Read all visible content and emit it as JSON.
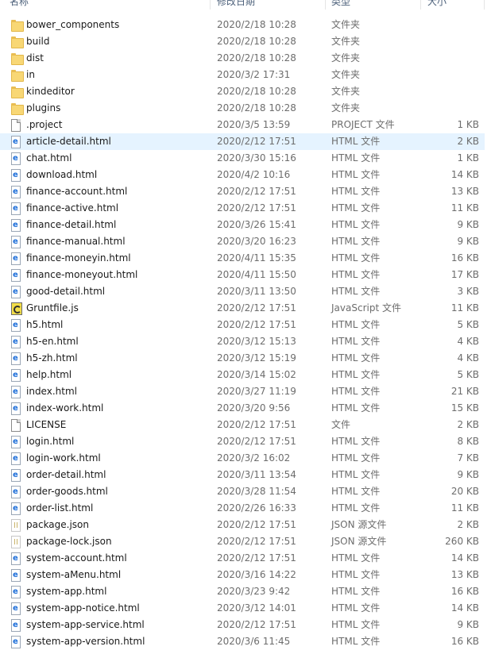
{
  "header": {
    "name": "名称",
    "date": "修改日期",
    "type": "类型",
    "size": "大小"
  },
  "files": [
    {
      "icon": "folder",
      "name": "bower_components",
      "date": "2020/2/18 10:28",
      "type": "文件夹",
      "size": ""
    },
    {
      "icon": "folder",
      "name": "build",
      "date": "2020/2/18 10:28",
      "type": "文件夹",
      "size": ""
    },
    {
      "icon": "folder",
      "name": "dist",
      "date": "2020/2/18 10:28",
      "type": "文件夹",
      "size": ""
    },
    {
      "icon": "folder",
      "name": "in",
      "date": "2020/3/2 17:31",
      "type": "文件夹",
      "size": ""
    },
    {
      "icon": "folder",
      "name": "kindeditor",
      "date": "2020/2/18 10:28",
      "type": "文件夹",
      "size": ""
    },
    {
      "icon": "folder",
      "name": "plugins",
      "date": "2020/2/18 10:28",
      "type": "文件夹",
      "size": ""
    },
    {
      "icon": "file",
      "name": ".project",
      "date": "2020/3/5 13:59",
      "type": "PROJECT 文件",
      "size": "1 KB"
    },
    {
      "icon": "html",
      "name": "article-detail.html",
      "date": "2020/2/12 17:51",
      "type": "HTML 文件",
      "size": "2 KB",
      "selected": true
    },
    {
      "icon": "html",
      "name": "chat.html",
      "date": "2020/3/30 15:16",
      "type": "HTML 文件",
      "size": "1 KB"
    },
    {
      "icon": "html",
      "name": "download.html",
      "date": "2020/4/2 10:16",
      "type": "HTML 文件",
      "size": "14 KB"
    },
    {
      "icon": "html",
      "name": "finance-account.html",
      "date": "2020/2/12 17:51",
      "type": "HTML 文件",
      "size": "13 KB"
    },
    {
      "icon": "html",
      "name": "finance-active.html",
      "date": "2020/2/12 17:51",
      "type": "HTML 文件",
      "size": "11 KB"
    },
    {
      "icon": "html",
      "name": "finance-detail.html",
      "date": "2020/3/26 15:41",
      "type": "HTML 文件",
      "size": "9 KB"
    },
    {
      "icon": "html",
      "name": "finance-manual.html",
      "date": "2020/3/20 16:23",
      "type": "HTML 文件",
      "size": "9 KB"
    },
    {
      "icon": "html",
      "name": "finance-moneyin.html",
      "date": "2020/4/11 15:35",
      "type": "HTML 文件",
      "size": "16 KB"
    },
    {
      "icon": "html",
      "name": "finance-moneyout.html",
      "date": "2020/4/11 15:50",
      "type": "HTML 文件",
      "size": "17 KB"
    },
    {
      "icon": "html",
      "name": "good-detail.html",
      "date": "2020/3/11 13:50",
      "type": "HTML 文件",
      "size": "3 KB"
    },
    {
      "icon": "js",
      "name": "Gruntfile.js",
      "date": "2020/2/12 17:51",
      "type": "JavaScript 文件",
      "size": "11 KB"
    },
    {
      "icon": "html",
      "name": "h5.html",
      "date": "2020/2/12 17:51",
      "type": "HTML 文件",
      "size": "5 KB"
    },
    {
      "icon": "html",
      "name": "h5-en.html",
      "date": "2020/3/12 15:13",
      "type": "HTML 文件",
      "size": "4 KB"
    },
    {
      "icon": "html",
      "name": "h5-zh.html",
      "date": "2020/3/12 15:19",
      "type": "HTML 文件",
      "size": "4 KB"
    },
    {
      "icon": "html",
      "name": "help.html",
      "date": "2020/3/14 15:02",
      "type": "HTML 文件",
      "size": "5 KB"
    },
    {
      "icon": "html",
      "name": "index.html",
      "date": "2020/3/27 11:19",
      "type": "HTML 文件",
      "size": "21 KB"
    },
    {
      "icon": "html",
      "name": "index-work.html",
      "date": "2020/3/20 9:56",
      "type": "HTML 文件",
      "size": "15 KB"
    },
    {
      "icon": "file",
      "name": "LICENSE",
      "date": "2020/2/12 17:51",
      "type": "文件",
      "size": "2 KB"
    },
    {
      "icon": "html",
      "name": "login.html",
      "date": "2020/2/12 17:51",
      "type": "HTML 文件",
      "size": "8 KB"
    },
    {
      "icon": "html",
      "name": "login-work.html",
      "date": "2020/3/2 16:02",
      "type": "HTML 文件",
      "size": "7 KB"
    },
    {
      "icon": "html",
      "name": "order-detail.html",
      "date": "2020/3/11 13:54",
      "type": "HTML 文件",
      "size": "9 KB"
    },
    {
      "icon": "html",
      "name": "order-goods.html",
      "date": "2020/3/28 11:54",
      "type": "HTML 文件",
      "size": "20 KB"
    },
    {
      "icon": "html",
      "name": "order-list.html",
      "date": "2020/2/26 16:33",
      "type": "HTML 文件",
      "size": "11 KB"
    },
    {
      "icon": "json",
      "name": "package.json",
      "date": "2020/2/12 17:51",
      "type": "JSON 源文件",
      "size": "2 KB"
    },
    {
      "icon": "json",
      "name": "package-lock.json",
      "date": "2020/2/12 17:51",
      "type": "JSON 源文件",
      "size": "260 KB"
    },
    {
      "icon": "html",
      "name": "system-account.html",
      "date": "2020/2/12 17:51",
      "type": "HTML 文件",
      "size": "14 KB"
    },
    {
      "icon": "html",
      "name": "system-aMenu.html",
      "date": "2020/3/16 14:22",
      "type": "HTML 文件",
      "size": "13 KB"
    },
    {
      "icon": "html",
      "name": "system-app.html",
      "date": "2020/3/23 9:42",
      "type": "HTML 文件",
      "size": "16 KB"
    },
    {
      "icon": "html",
      "name": "system-app-notice.html",
      "date": "2020/3/12 14:01",
      "type": "HTML 文件",
      "size": "14 KB"
    },
    {
      "icon": "html",
      "name": "system-app-service.html",
      "date": "2020/2/12 17:51",
      "type": "HTML 文件",
      "size": "9 KB"
    },
    {
      "icon": "html",
      "name": "system-app-version.html",
      "date": "2020/3/6 11:45",
      "type": "HTML 文件",
      "size": "16 KB"
    }
  ]
}
